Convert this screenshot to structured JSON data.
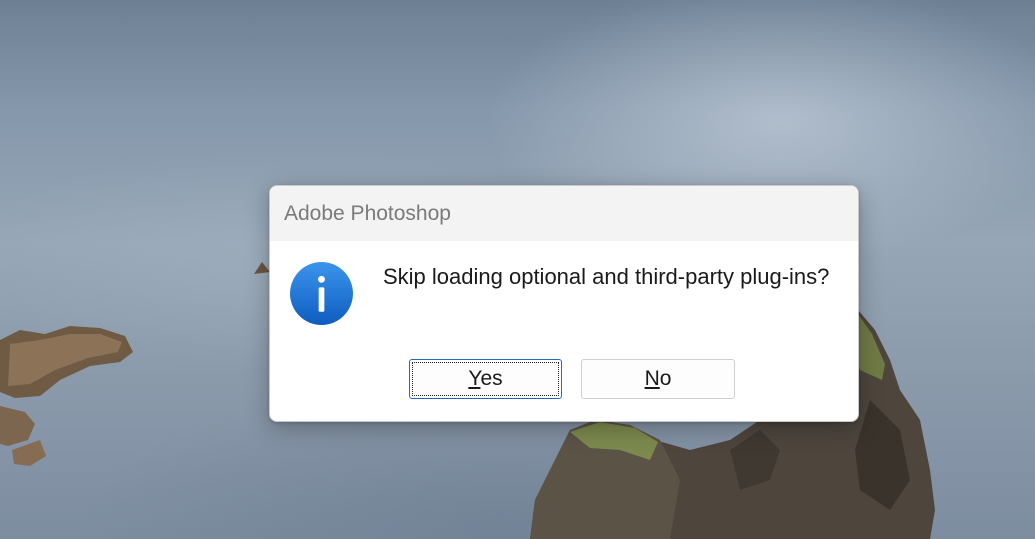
{
  "dialog": {
    "title": "Adobe Photoshop",
    "icon": "info-icon",
    "message": "Skip loading optional and third-party plug-ins?",
    "buttons": {
      "yes_label": "Yes",
      "no_label": "No"
    },
    "default_button": "Yes"
  },
  "colors": {
    "icon_blue": "#1e74d6",
    "default_button_border": "#2b68c4",
    "titlebar": "#f3f3f3"
  }
}
